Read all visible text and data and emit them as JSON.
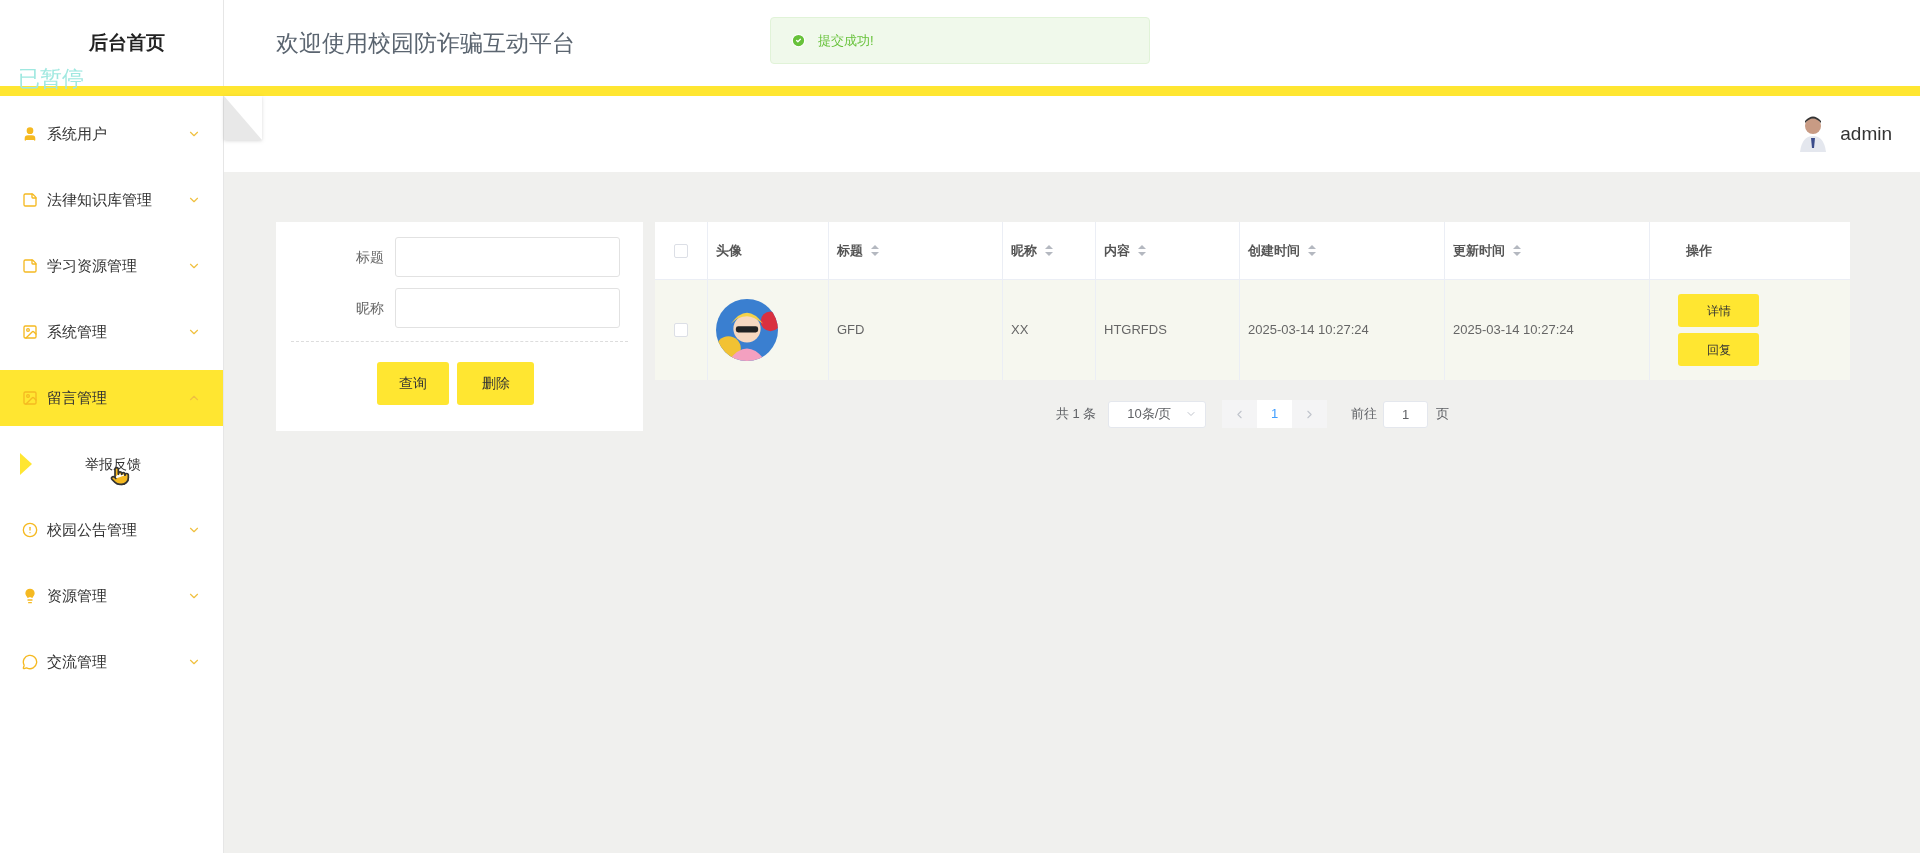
{
  "sidebar": {
    "title": "后台首页",
    "overlay_label": "已暂停",
    "items": [
      {
        "label": "系统用户",
        "expanded": false
      },
      {
        "label": "法律知识库管理",
        "expanded": false
      },
      {
        "label": "学习资源管理",
        "expanded": false
      },
      {
        "label": "系统管理",
        "expanded": false
      },
      {
        "label": "留言管理",
        "expanded": true,
        "children": [
          {
            "label": "举报反馈",
            "selected": true
          }
        ]
      },
      {
        "label": "校园公告管理",
        "expanded": false
      },
      {
        "label": "资源管理",
        "expanded": false
      },
      {
        "label": "交流管理",
        "expanded": false
      }
    ]
  },
  "header": {
    "title": "欢迎使用校园防诈骗互动平台",
    "toast": "提交成功!",
    "user": "admin"
  },
  "search": {
    "fields": [
      {
        "label": "标题"
      },
      {
        "label": "昵称"
      }
    ],
    "buttons": [
      "查询",
      "删除"
    ]
  },
  "table": {
    "columns": [
      {
        "label": "头像",
        "sortable": false
      },
      {
        "label": "标题",
        "sortable": true
      },
      {
        "label": "昵称",
        "sortable": true
      },
      {
        "label": "内容",
        "sortable": true
      },
      {
        "label": "创建时间",
        "sortable": true
      },
      {
        "label": "更新时间",
        "sortable": true
      },
      {
        "label": "操作",
        "sortable": false
      }
    ],
    "select_all": {
      "checked": false
    },
    "rows": [
      {
        "checked": false,
        "cells": [
          {
            "kind": "picture"
          },
          {
            "kind": "text",
            "text": "GFD"
          },
          {
            "kind": "text",
            "text": "XX"
          },
          {
            "kind": "text",
            "text": "HTGRFDS"
          },
          {
            "kind": "text",
            "text": "2025-03-14 10:27:24"
          },
          {
            "kind": "text",
            "text": "2025-03-14 10:27:24"
          },
          {
            "kind": "actions",
            "actions": [
              "详情",
              "回复"
            ]
          }
        ]
      }
    ]
  },
  "pagination": {
    "total": "共 1 条",
    "page_size": "10条/页",
    "pages": [
      {
        "label": "1",
        "selected": true
      }
    ],
    "goto_label": "前往",
    "goto_value": "1",
    "goto_suffix": "页"
  }
}
